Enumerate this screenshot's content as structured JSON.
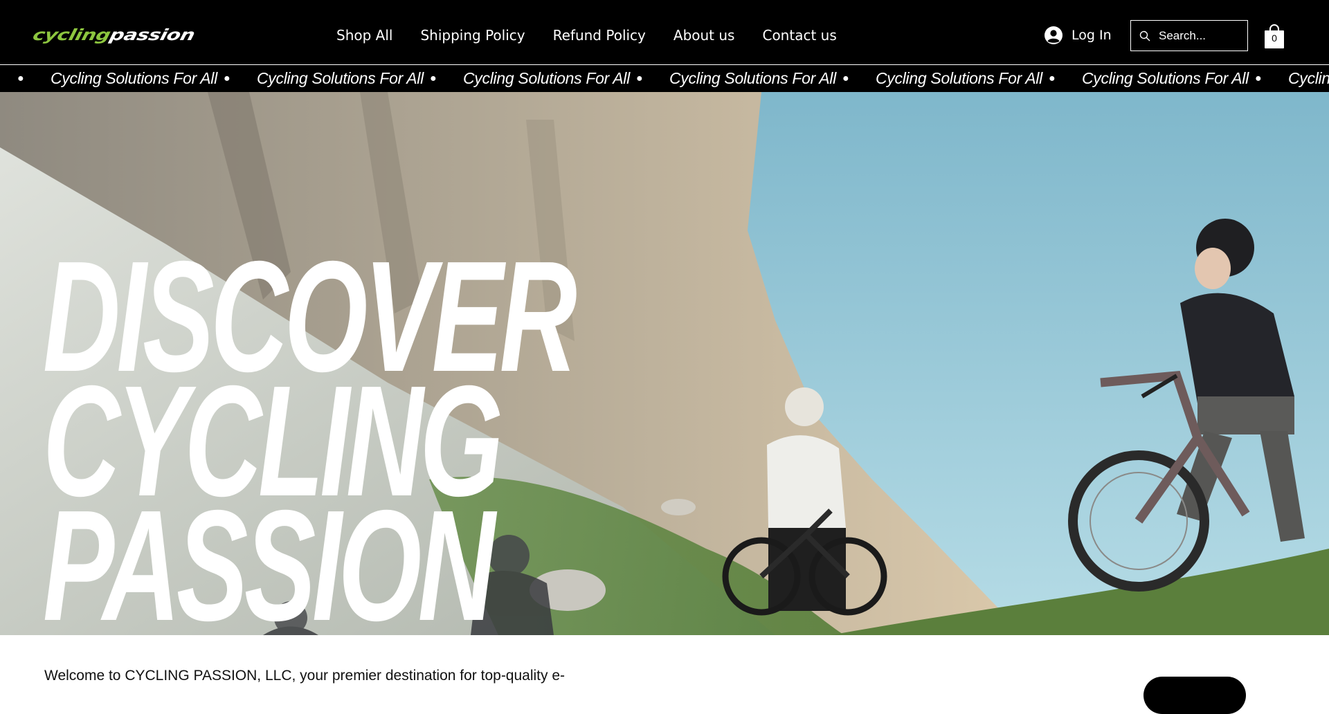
{
  "header": {
    "logo": {
      "part1": "cycling",
      "part2": "passion"
    },
    "nav": [
      "Shop All",
      "Shipping Policy",
      "Refund Policy",
      "About us",
      "Contact us"
    ],
    "login_label": "Log In",
    "search_placeholder": "Search...",
    "cart_count": "0"
  },
  "marquee": {
    "text": "Cycling Solutions For All",
    "items": [
      "Cycling Solutions For All",
      "Cycling Solutions For All",
      "Cycling Solutions For All",
      "Cycling Solutions For All",
      "Cycling Solutions For All",
      "Cycling Solutions For All",
      "Cycling Solutions For All"
    ]
  },
  "hero": {
    "lines": [
      "DISCOVER",
      "CYCLING",
      "PASSION"
    ]
  },
  "intro": {
    "welcome": "Welcome to CYCLING PASSION, LLC, your premier destination for top-quality e-"
  },
  "colors": {
    "header_bg": "#000000",
    "logo_accent": "#8dc63f",
    "sky": "#8fc4d8",
    "rock": "#cbbfa8",
    "grass": "#5e8a3e"
  }
}
